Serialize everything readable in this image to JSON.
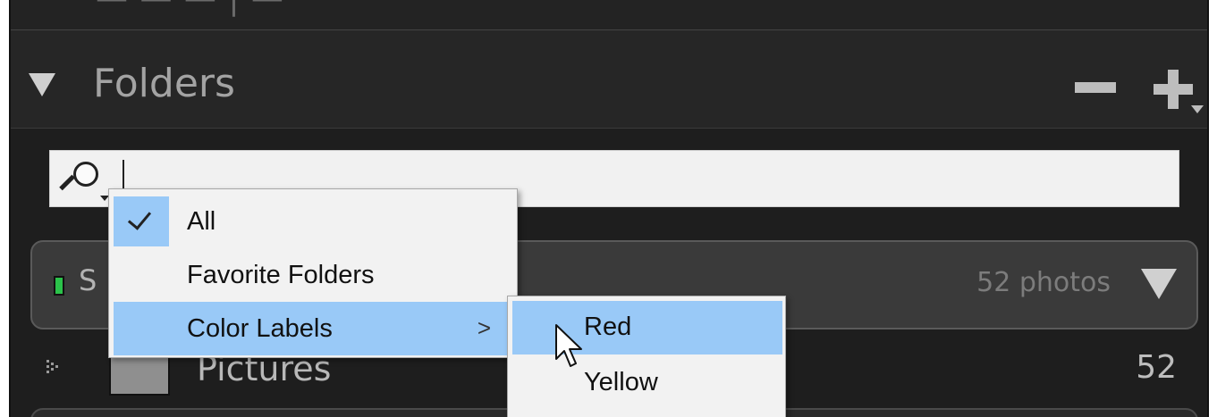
{
  "panel": {
    "title": "Folders",
    "top_strip_text": "— — —  |  —"
  },
  "header_buttons": {
    "minus_icon": "minus-icon",
    "plus_icon": "plus-icon"
  },
  "search": {
    "value": "",
    "icon": "search-icon"
  },
  "source": {
    "name": "S",
    "photo_count": "52 photos",
    "indicator_color": "#2bc24a"
  },
  "folders": [
    {
      "name": "Pictures",
      "count": "52"
    }
  ],
  "filter_menu": {
    "items": [
      {
        "label": "All",
        "checked": true
      },
      {
        "label": "Favorite Folders",
        "checked": false
      },
      {
        "label": "Color Labels",
        "has_submenu": true,
        "highlighted": true
      }
    ],
    "submenu_glyph": ">"
  },
  "color_labels_submenu": {
    "items": [
      {
        "label": "Red",
        "highlighted": true
      },
      {
        "label": "Yellow",
        "highlighted": false
      }
    ]
  },
  "colors": {
    "menu_highlight": "#99c9f7",
    "panel_bg": "#1d1d1d"
  }
}
